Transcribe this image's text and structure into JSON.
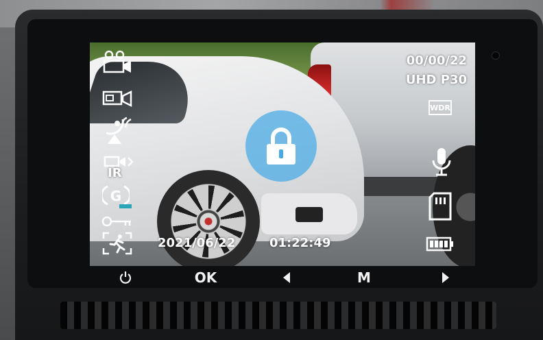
{
  "screen": {
    "date": "2021/06/22",
    "time": "01:22:49",
    "elapsed": "00/00/22",
    "resolution": "UHD P30",
    "wdr_label": "WDR",
    "ir_label": "IR",
    "gsensor_label": "G"
  },
  "icons": {
    "left": [
      "dual-camera-icon",
      "front-camera-icon",
      "satellite-gps-icon",
      "ir-camera-icon",
      "g-sensor-icon",
      "parking-key-icon",
      "motion-detection-icon"
    ],
    "right": [
      "wdr-icon",
      "microphone-icon",
      "sd-card-icon",
      "battery-icon"
    ],
    "center": "lock-icon"
  },
  "buttons": {
    "power_icon": "power-icon",
    "ok_label": "OK",
    "left_icon": "left-arrow-icon",
    "menu_label": "M",
    "right_icon": "right-arrow-icon"
  },
  "colors": {
    "lock_overlay": "#46aae6",
    "accent_teal": "#2aa6b8",
    "body": "#1c1d1f"
  }
}
